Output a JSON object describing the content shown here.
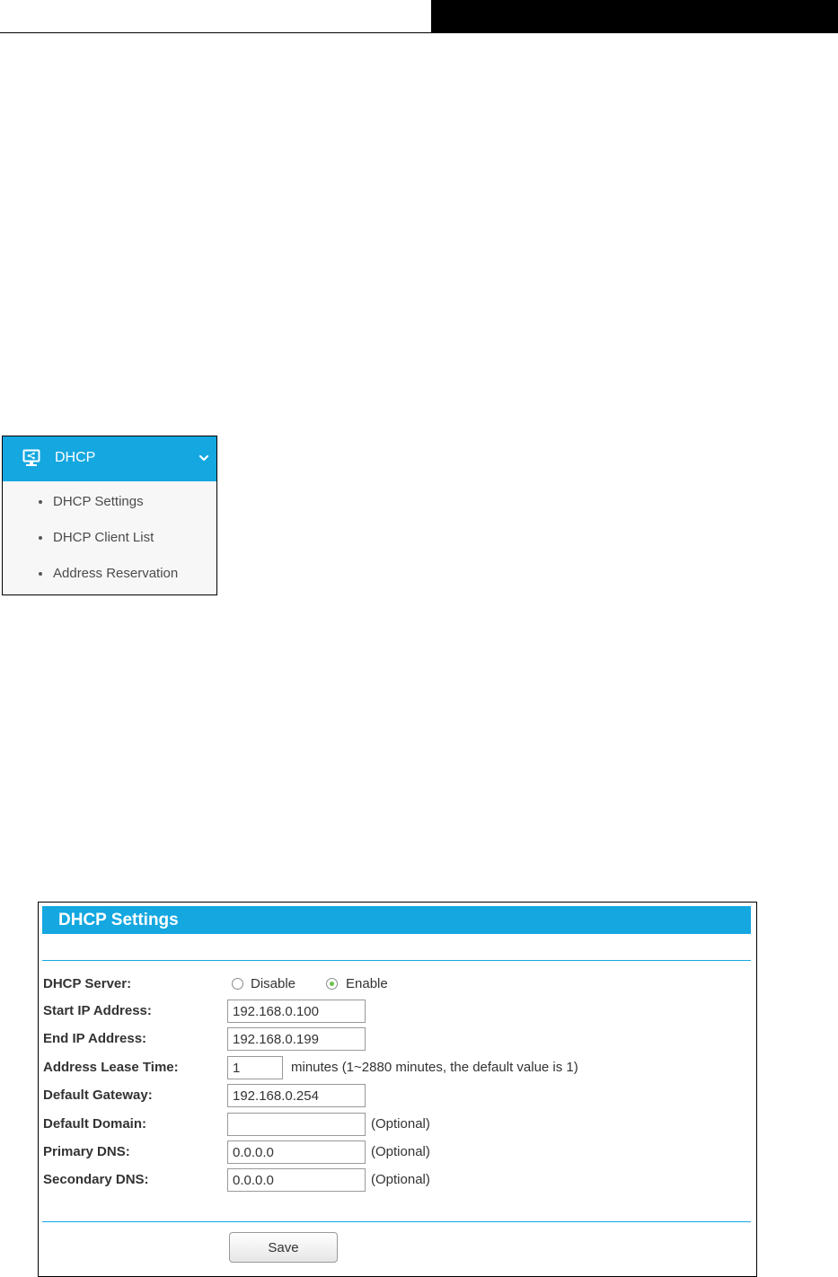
{
  "menu": {
    "title": "DHCP",
    "items": [
      {
        "label": "DHCP Settings"
      },
      {
        "label": "DHCP Client List"
      },
      {
        "label": "Address Reservation"
      }
    ],
    "accent_color": "#14a7e0"
  },
  "settings": {
    "title": "DHCP Settings",
    "dhcp_server": {
      "label": "DHCP Server:",
      "disable_label": "Disable",
      "enable_label": "Enable",
      "selected": "Enable"
    },
    "start_ip": {
      "label": "Start IP Address:",
      "value": "192.168.0.100"
    },
    "end_ip": {
      "label": "End IP Address:",
      "value": "192.168.0.199"
    },
    "lease_time": {
      "label": "Address Lease Time:",
      "value": "1",
      "hint": "minutes (1~2880 minutes, the default value is 1)"
    },
    "gateway": {
      "label": "Default Gateway:",
      "value": "192.168.0.254"
    },
    "domain": {
      "label": "Default Domain:",
      "value": "",
      "hint": "(Optional)"
    },
    "primary_dns": {
      "label": "Primary DNS:",
      "value": "0.0.0.0",
      "hint": "(Optional)"
    },
    "secondary_dns": {
      "label": "Secondary DNS:",
      "value": "0.0.0.0",
      "hint": "(Optional)"
    },
    "save_label": "Save"
  }
}
